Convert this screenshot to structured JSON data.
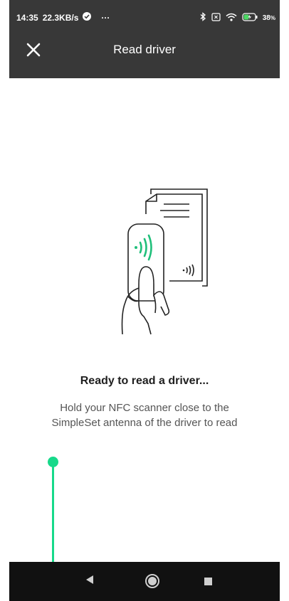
{
  "status_bar": {
    "time": "14:35",
    "speed": "22.3KB/s",
    "more": "···",
    "battery_level": "38",
    "battery_percent_sign": "%"
  },
  "app_bar": {
    "title": "Read driver",
    "close_icon": "close-icon"
  },
  "main": {
    "illustration": "nfc-scanner-illustration",
    "heading": "Ready to read a driver...",
    "description_line1": "Hold your NFC scanner close to the",
    "description_line2": "SimpleSet antenna of the driver to read"
  },
  "nav_bar": {
    "icons": [
      "back-icon",
      "home-icon",
      "recent-apps-icon"
    ]
  },
  "colors": {
    "bar_background": "#383838",
    "nav_background": "#111111",
    "accent_green": "#17d98a",
    "nfc_green": "#1fbf7a"
  }
}
